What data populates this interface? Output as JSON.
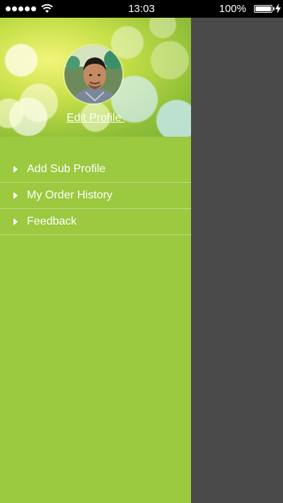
{
  "status_bar": {
    "time": "13:03",
    "battery_percent": "100%",
    "battery_level": 1.0,
    "signal_dots": 5,
    "icons": [
      "signal-dots-icon",
      "wifi-icon",
      "battery-icon",
      "charging-bolt-icon"
    ]
  },
  "drawer": {
    "background_color": "#9bc93f",
    "profile": {
      "edit_label": "Edit Profile "
    },
    "menu": [
      {
        "label": "Add Sub Profile",
        "icon": "arrow-right-icon"
      },
      {
        "label": "My Order History",
        "icon": "arrow-right-icon"
      },
      {
        "label": "Feedback",
        "icon": "arrow-right-icon"
      }
    ]
  },
  "overlay_color": "#4a4a4a"
}
